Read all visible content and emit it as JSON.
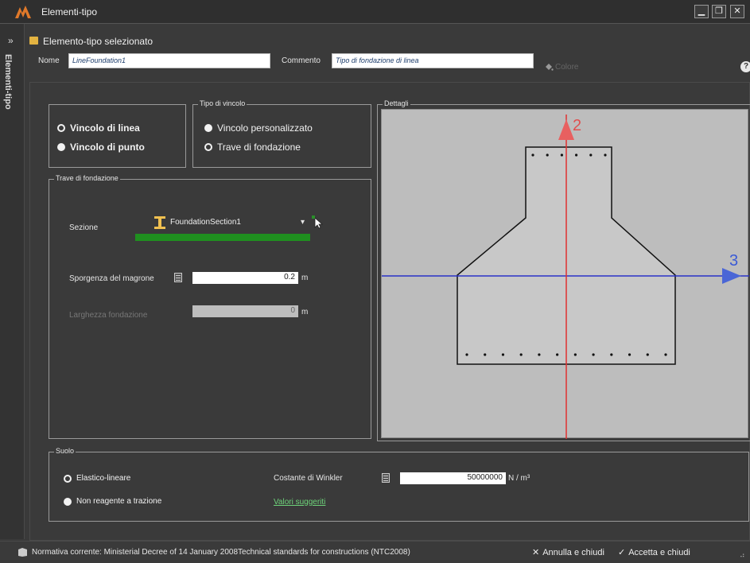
{
  "window": {
    "title": "Elementi-tipo"
  },
  "side_tab": {
    "label": "Elementi-tipo"
  },
  "header": {
    "title": "Elemento-tipo selezionato"
  },
  "fields": {
    "nome_label": "Nome",
    "nome_value": "LineFoundation1",
    "commento_label": "Commento",
    "commento_value": "Tipo di fondazione di linea",
    "colore_label": "Colore",
    "help": "?"
  },
  "vincolo_group": {
    "options": [
      "Vincolo di linea",
      "Vincolo di punto"
    ],
    "selected": 0
  },
  "tipo_vincolo": {
    "title": "Tipo di vincolo",
    "options": [
      "Vincolo personalizzato",
      "Trave di fondazione"
    ],
    "selected": 1
  },
  "trave": {
    "title": "Trave di fondazione",
    "sezione_label": "Sezione",
    "sezione_value": "FoundationSection1",
    "magrone_label": "Sporgenza del magrone",
    "magrone_value": "0.2",
    "magrone_unit": "m",
    "larghezza_label": "Larghezza fondazione",
    "larghezza_value": "0",
    "larghezza_unit": "m"
  },
  "dettagli": {
    "title": "Dettagli",
    "axis_vertical": "2",
    "axis_horizontal": "3"
  },
  "suolo": {
    "title": "Suolo",
    "options": [
      "Elastico-lineare",
      "Non reagente a trazione"
    ],
    "selected": 0,
    "winkler_label": "Costante di Winkler",
    "winkler_value": "50000000",
    "winkler_unit": "N / m³",
    "suggested_link": "Valori suggeriti"
  },
  "statusbar": {
    "normativa": "Normativa corrente:  Ministerial Decree of 14 January 2008Technical standards for constructions (NTC2008)",
    "cancel": "Annulla e chiudi",
    "accept": "Accetta e chiudi"
  },
  "colors": {
    "green_bar": "#1f8f1f",
    "axis_red": "#e03030",
    "axis_blue": "#2a32c8",
    "link_green": "#6ed47a"
  }
}
